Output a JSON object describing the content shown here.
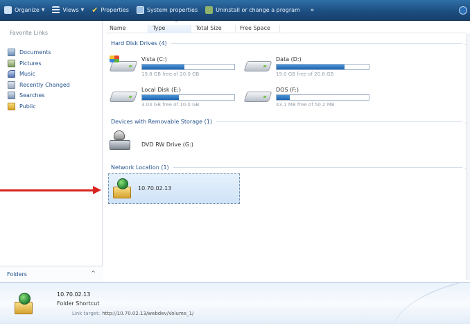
{
  "toolbar": {
    "organize": "Organize",
    "views": "Views",
    "properties": "Properties",
    "system_properties": "System properties",
    "uninstall": "Uninstall or change a program",
    "more": "»"
  },
  "sidebar": {
    "title": "Favorite Links",
    "items": [
      {
        "label": "Documents",
        "icon": "documents-icon"
      },
      {
        "label": "Pictures",
        "icon": "pictures-icon"
      },
      {
        "label": "Music",
        "icon": "music-icon"
      },
      {
        "label": "Recently Changed",
        "icon": "recently-changed-icon"
      },
      {
        "label": "Searches",
        "icon": "searches-icon"
      },
      {
        "label": "Public",
        "icon": "public-icon"
      }
    ],
    "folders_label": "Folders",
    "folders_caret": "^"
  },
  "columns": {
    "name": "Name",
    "type": "Type",
    "total_size": "Total Size",
    "free_space": "Free Space"
  },
  "groups": {
    "hard_disk": "Hard Disk Drives (4)",
    "removable": "Devices with Removable Storage (1)",
    "network": "Network Location (1)"
  },
  "drives": [
    {
      "name": "Vista (C:)",
      "space": "19.8 GB free of 20.0 GB",
      "fill": 0.46
    },
    {
      "name": "Data (D:)",
      "space": "19.0 GB free of 20.8 GB",
      "fill": 0.74
    },
    {
      "name": "Local Disk (E:)",
      "space": "3.04 GB free of 10.0 GB",
      "fill": 0.4
    },
    {
      "name": "DOS (F:)",
      "space": "43.1 MB free of 50.2 MB",
      "fill": 0.14
    }
  ],
  "dvd": {
    "name": "DVD RW Drive (G:)"
  },
  "network_item": {
    "name": "10.70.02.13"
  },
  "details": {
    "name": "10.70.02.13",
    "type": "Folder Shortcut",
    "target_label": "Link target:",
    "target": "http://10.70.02.13/webdev/Volume_1/"
  },
  "colors": {
    "toolbar": "#1d4f82",
    "link": "#1f4f8a",
    "progress": "#1f63ad",
    "arrow": "#d8231f",
    "selection": "#cfe3f7"
  }
}
